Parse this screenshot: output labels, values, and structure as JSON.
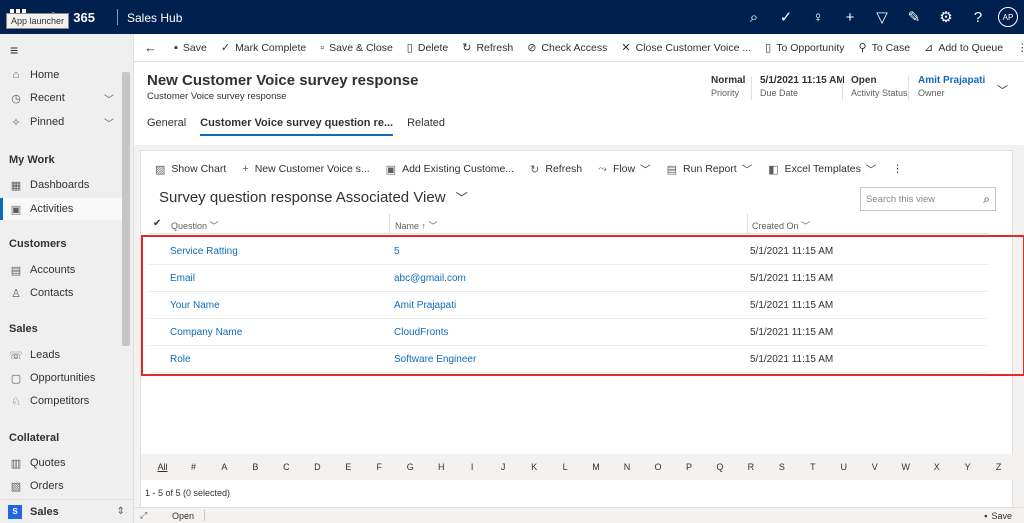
{
  "topbar": {
    "brand": "mics 365",
    "app_name": "Sales Hub",
    "tooltip": "App launcher",
    "avatar_initials": "AP"
  },
  "leftnav": {
    "items": [
      {
        "label": "Home",
        "icon": "home-icon"
      },
      {
        "label": "Recent",
        "icon": "clock-icon"
      },
      {
        "label": "Pinned",
        "icon": "pin-icon"
      }
    ],
    "groups": [
      {
        "title": "My Work",
        "items": [
          {
            "label": "Dashboards"
          },
          {
            "label": "Activities"
          }
        ]
      },
      {
        "title": "Customers",
        "items": [
          {
            "label": "Accounts"
          },
          {
            "label": "Contacts"
          }
        ]
      },
      {
        "title": "Sales",
        "items": [
          {
            "label": "Leads"
          },
          {
            "label": "Opportunities"
          },
          {
            "label": "Competitors"
          }
        ]
      },
      {
        "title": "Collateral",
        "items": [
          {
            "label": "Quotes"
          },
          {
            "label": "Orders"
          }
        ]
      }
    ],
    "area": {
      "badge": "S",
      "label": "Sales"
    }
  },
  "commandbar": {
    "save": "Save",
    "mark_complete": "Mark Complete",
    "save_close": "Save & Close",
    "delete": "Delete",
    "refresh": "Refresh",
    "check_access": "Check Access",
    "close_voice": "Close Customer Voice ...",
    "to_opportunity": "To Opportunity",
    "to_case": "To Case",
    "add_to_queue": "Add to Queue"
  },
  "header": {
    "title": "New Customer Voice survey response",
    "subtitle": "Customer Voice survey response",
    "fields": [
      {
        "value": "Normal",
        "label": "Priority"
      },
      {
        "value": "5/1/2021 11:15 AM",
        "label": "Due Date"
      },
      {
        "value": "Open",
        "label": "Activity Status"
      },
      {
        "value": "Amit Prajapati",
        "label": "Owner"
      }
    ],
    "tabs": [
      "General",
      "Customer Voice survey question re...",
      "Related"
    ],
    "selected_tab": 1
  },
  "subgrid": {
    "commands": {
      "show_chart": "Show Chart",
      "new": "New Customer Voice s...",
      "add_existing": "Add Existing Custome...",
      "refresh": "Refresh",
      "flow": "Flow",
      "run_report": "Run Report",
      "excel_templates": "Excel Templates"
    },
    "view_title": "Survey question response Associated View",
    "search_placeholder": "Search this view",
    "columns": {
      "question": "Question",
      "name": "Name",
      "created_on": "Created On"
    },
    "rows": [
      {
        "question": "Service Ratting",
        "name": "5",
        "created_on": "5/1/2021 11:15 AM"
      },
      {
        "question": "Email",
        "name": "abc@gmail.com",
        "created_on": "5/1/2021 11:15 AM"
      },
      {
        "question": "Your Name",
        "name": "Amit Prajapati",
        "created_on": "5/1/2021 11:15 AM"
      },
      {
        "question": "Company Name",
        "name": "CloudFronts",
        "created_on": "5/1/2021 11:15 AM"
      },
      {
        "question": "Role",
        "name": "Software Engineer",
        "created_on": "5/1/2021 11:15 AM"
      }
    ],
    "alphabet": [
      "All",
      "#",
      "A",
      "B",
      "C",
      "D",
      "E",
      "F",
      "G",
      "H",
      "I",
      "J",
      "K",
      "L",
      "M",
      "N",
      "O",
      "P",
      "Q",
      "R",
      "S",
      "T",
      "U",
      "V",
      "W",
      "X",
      "Y",
      "Z"
    ],
    "record_count": "1 - 5 of 5 (0 selected)"
  },
  "statusbar": {
    "status": "Open",
    "save": "Save"
  },
  "colors": {
    "nav": "#002050",
    "accent": "#0f6cbd",
    "highlight": "#e02b2b"
  }
}
